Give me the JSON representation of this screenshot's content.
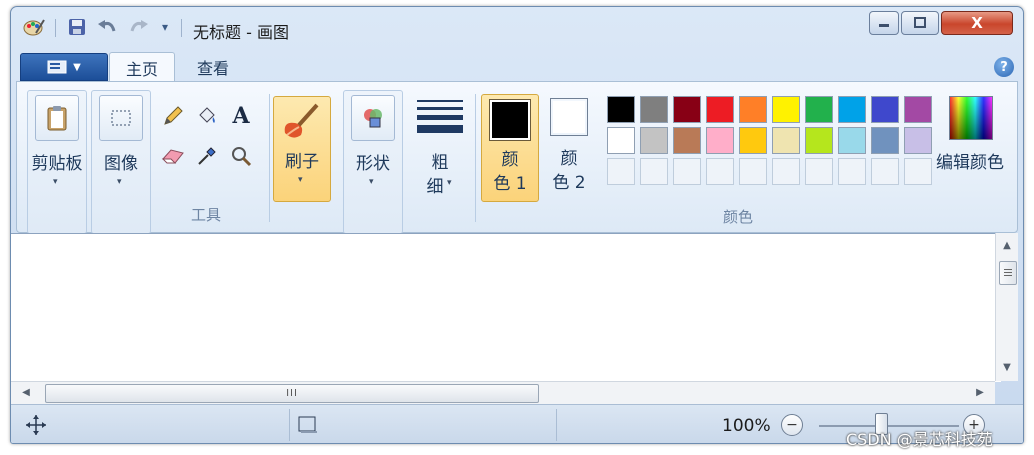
{
  "window": {
    "title": "无标题 - 画图",
    "quick_access": {
      "save_icon": "save-icon",
      "undo_icon": "undo-icon",
      "redo_icon": "redo-icon",
      "customize": "▾"
    },
    "controls": {
      "minimize": "–",
      "maximize": "☐",
      "close": "X"
    }
  },
  "tabs": [
    {
      "label": "主页",
      "active": true
    },
    {
      "label": "查看",
      "active": false
    }
  ],
  "ribbon": {
    "clipboard": {
      "label": "剪贴板",
      "arrow": "▾"
    },
    "image": {
      "label": "图像",
      "arrow": "▾"
    },
    "tools": {
      "title": "工具",
      "items": [
        "pencil-icon",
        "fill-icon",
        "text-icon",
        "eraser-icon",
        "color-picker-icon",
        "magnifier-icon"
      ],
      "text_glyph": "A"
    },
    "brushes": {
      "label": "刷子",
      "arrow": "▾"
    },
    "shapes": {
      "label": "形状",
      "arrow": "▾"
    },
    "size": {
      "label_line1": "粗",
      "label_line2": "细",
      "arrow": "▾"
    },
    "color1": {
      "label_line1": "颜",
      "label_line2": "色 1",
      "value": "#000000"
    },
    "color2": {
      "label_line1": "颜",
      "label_line2": "色 2",
      "value": "#ffffff"
    },
    "colors": {
      "title": "颜色",
      "row1": [
        "#000000",
        "#7f7f7f",
        "#880015",
        "#ed1c24",
        "#ff7f27",
        "#fff200",
        "#22b14c",
        "#00a2e8",
        "#3f48cc",
        "#a349a4"
      ],
      "row2": [
        "#ffffff",
        "#c3c3c3",
        "#b97a57",
        "#ffaec9",
        "#ffc90e",
        "#efe4b0",
        "#b5e61d",
        "#99d9ea",
        "#7092be",
        "#c8bfe7"
      ]
    },
    "edit_colors": {
      "label": "编辑颜色"
    }
  },
  "scroll": {
    "thumb_grip": "III"
  },
  "status": {
    "zoom": "100%",
    "zoom_level": 1.0,
    "zoom_out": "−",
    "zoom_in": "+"
  },
  "watermark": "CSDN @景芯科技苑"
}
